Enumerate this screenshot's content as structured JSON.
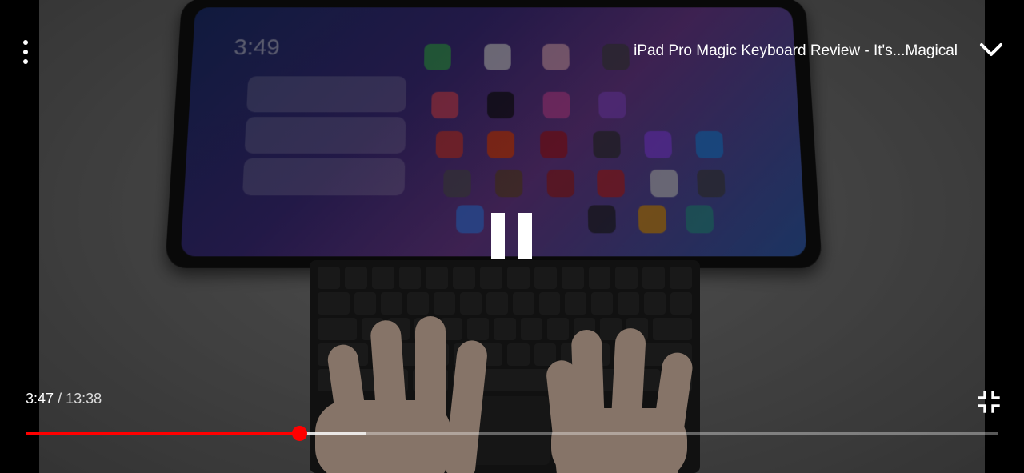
{
  "video": {
    "title": "iPad Pro Magic Keyboard Review - It's...Magical"
  },
  "playback": {
    "current_time": "3:47",
    "duration": "13:38",
    "separator": "/",
    "played_fraction": 0.281,
    "buffered_fraction": 0.35,
    "state": "playing"
  },
  "controls": {
    "menu_icon": "more-vertical-icon",
    "collapse_icon": "chevron-down-icon",
    "center_icon": "pause-icon",
    "fullscreen_icon": "exit-fullscreen-icon"
  },
  "colors": {
    "progress_played": "#ff0000",
    "background": "#000000"
  }
}
